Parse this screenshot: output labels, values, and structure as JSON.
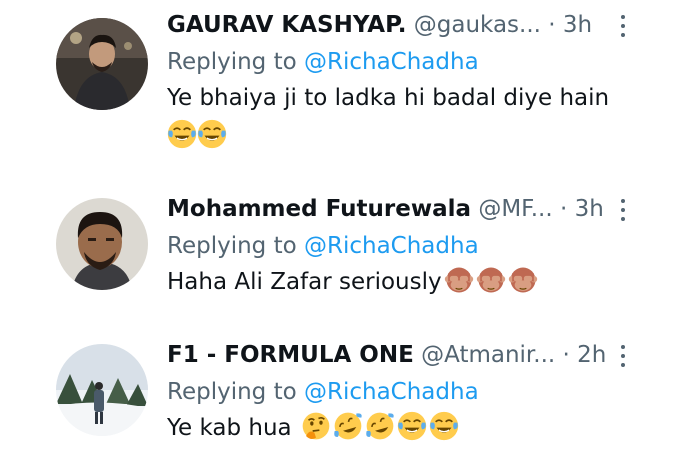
{
  "replies": [
    {
      "name": "GAURAV  KASHYAP.",
      "handle": "@gaukas...",
      "dot": "·",
      "time": "3h",
      "replying_prefix": "Replying to",
      "replying_to": "@RichaChadha",
      "text": "Ye bhaiya ji to ladka hi badal diye hain",
      "emojis": [
        "face-with-tears-of-joy-emoji",
        "face-with-tears-of-joy-emoji"
      ]
    },
    {
      "name": "Mohammed Futurewala",
      "handle": "@MF...",
      "dot": "·",
      "time": "3h",
      "replying_prefix": "Replying to",
      "replying_to": "@RichaChadha",
      "text": "Haha Ali Zafar seriously",
      "emojis": [
        "see-no-evil-monkey-emoji",
        "see-no-evil-monkey-emoji",
        "see-no-evil-monkey-emoji"
      ]
    },
    {
      "name": "F1 - FORMULA ONE",
      "handle": "@Atmanir...",
      "dot": "·",
      "time": "2h",
      "replying_prefix": "Replying to",
      "replying_to": "@RichaChadha",
      "text": "Ye kab hua",
      "emojis": [
        "thinking-face-emoji",
        "rolling-on-floor-laughing-emoji",
        "rolling-on-floor-laughing-emoji",
        "face-with-tears-of-joy-emoji",
        "face-with-tears-of-joy-emoji"
      ]
    }
  ],
  "colors": {
    "text": "#0f1419",
    "secondary": "#536471",
    "link": "#1d9bf0",
    "emoji_yellow": "#ffcc4d",
    "tears": "#5dadec"
  }
}
